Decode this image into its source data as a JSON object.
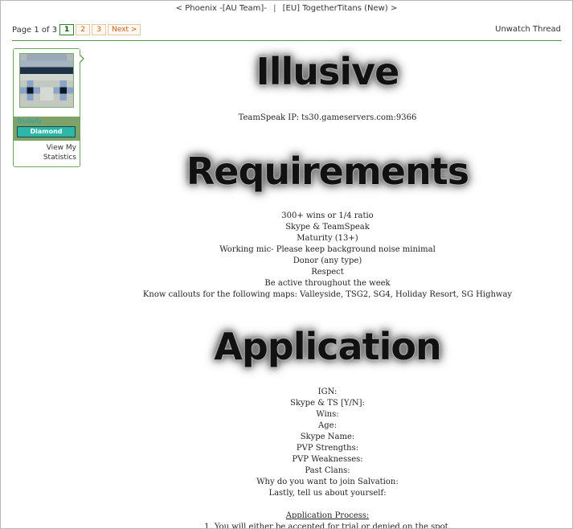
{
  "thread_nav": {
    "prev": "< Phoenix -[AU Team]-",
    "separator": "|",
    "next": "[EU] TogetherTitans (New) >"
  },
  "pagination": {
    "info": "Page 1 of 3",
    "pages": [
      "1",
      "2",
      "3"
    ],
    "current": "1",
    "next_label": "Next >"
  },
  "unwatch_label": "Unwatch Thread",
  "user": {
    "name": "Trudolly",
    "rank": "Diamond",
    "stats_line1": "View My",
    "stats_line2": "Statistics",
    "accent": "#2db7a9"
  },
  "post": {
    "title": "Illusive",
    "teamspeak": "TeamSpeak IP: ts30.gameservers.com:9366",
    "requirements_heading": "Requirements",
    "requirements": [
      "300+ wins or 1/4 ratio",
      "Skype & TeamSpeak",
      "Maturity (13+)",
      "Working mic- Please keep background noise minimal",
      "Donor (any type)",
      "Respect",
      "Be active throughout the week",
      "Know callouts for the following maps: Valleyside, TSG2, SG4, Holiday Resort, SG Highway"
    ],
    "application_heading": "Application",
    "application_fields": [
      "IGN:",
      "Skype & TS [Y/N]:",
      "Wins:",
      "Age:",
      "Skype Name:",
      "PVP Strengths:",
      "PVP Weaknesses:",
      "Past Clans:",
      "Why do you want to join Salvation:",
      "Lastly, tell us about yourself:"
    ],
    "process_heading": "Application Process:",
    "process_steps": [
      "1. You will either be accepted for trial or denied on the spot."
    ]
  }
}
